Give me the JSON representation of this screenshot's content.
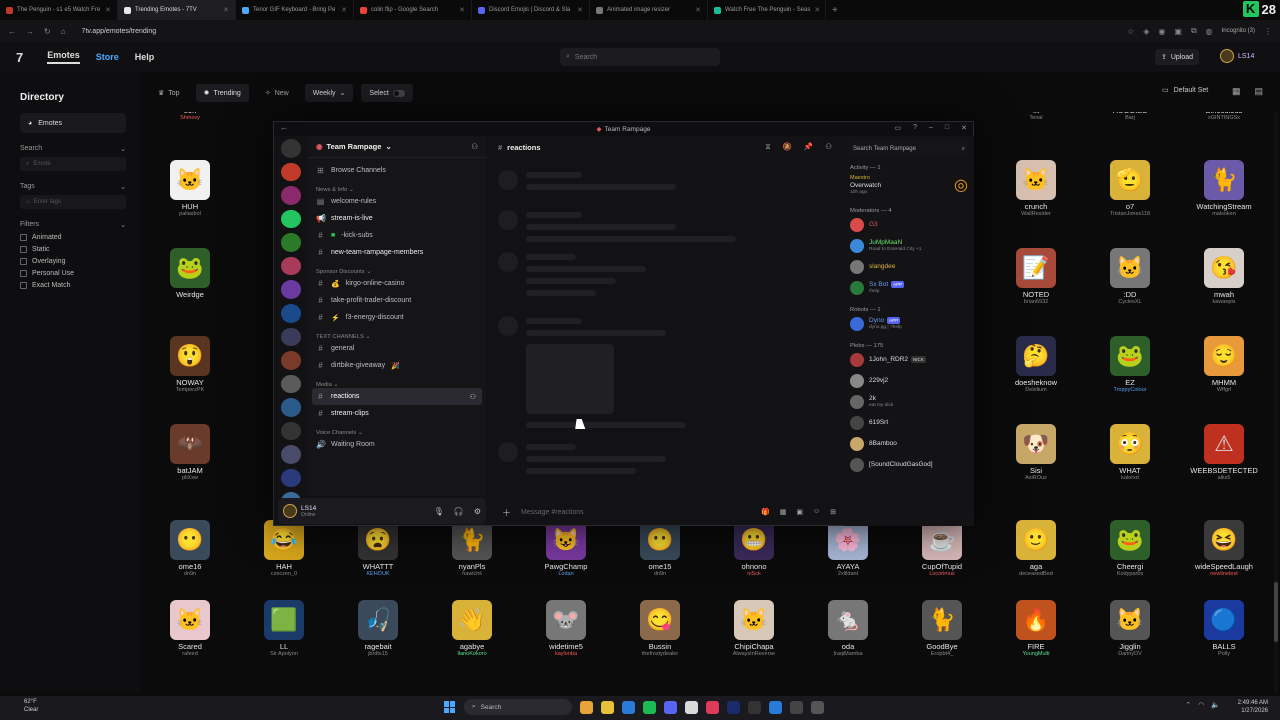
{
  "browser": {
    "tabs": [
      {
        "title": "The Penguin - s1 e5 Watch Fre",
        "color": "#c0392b"
      },
      {
        "title": "Trending Emotes - 7TV",
        "color": "#e8e8e8",
        "active": true
      },
      {
        "title": "Tenor GIF Keyboard - Bring Pe",
        "color": "#4aa8ff"
      },
      {
        "title": "colin flip - Google Search",
        "color": "#ea4335"
      },
      {
        "title": "Discord Emojis | Discord & Sla",
        "color": "#5865f2"
      },
      {
        "title": "Animated image resizer",
        "color": "#777777"
      },
      {
        "title": "Watch Free The Penguin - Seas",
        "color": "#1abc9c"
      }
    ],
    "url": "7tv.app/emotes/trending",
    "incognito": "Incognito (3)",
    "kick_count": "28"
  },
  "site": {
    "nav": {
      "emotes": "Emotes",
      "store": "Store",
      "help": "Help"
    },
    "search_placeholder": "Search",
    "upload": "Upload",
    "username": "LS14"
  },
  "sidebar": {
    "title": "Directory",
    "category": "Emotes",
    "search_label": "Search",
    "search_placeholder": "Emote",
    "tags_label": "Tags",
    "tags_placeholder": "Enter tags",
    "filters_label": "Filters",
    "filters": [
      "Animated",
      "Static",
      "Overlaying",
      "Personal Use",
      "Exact Match"
    ]
  },
  "filterbar": {
    "top": "Top",
    "trending": "Trending",
    "new": "New",
    "period": "Weekly",
    "select": "Select",
    "default_set": "Default Set"
  },
  "emotes": [
    {
      "name": "eon",
      "author": "Shmovy",
      "icon": "",
      "bg": "#222",
      "c": "red",
      "row": 0,
      "col": 0
    },
    {
      "name": "HUH",
      "author": "paliasbol",
      "icon": "🐱",
      "bg": "#f1f1f1",
      "row": 1,
      "col": 0
    },
    {
      "name": "Weirdge",
      "author": "",
      "icon": "🐸",
      "bg": "#2e5e2a",
      "row": 2,
      "col": 0
    },
    {
      "name": "NOWAY",
      "author": "TemperzPK",
      "icon": "😲",
      "bg": "#5a3520",
      "row": 3,
      "col": 0
    },
    {
      "name": "batJAM",
      "author": "pliXxw",
      "icon": "🦇",
      "bg": "#6a3a2a",
      "row": 4,
      "col": 0
    },
    {
      "name": "ome16",
      "author": "dn9n",
      "icon": "😶",
      "bg": "#3a4a5a",
      "row": 5,
      "col": 0
    },
    {
      "name": "Scared",
      "author": "rafeed",
      "icon": "🐱",
      "bg": "#e8c8cc",
      "row": 6,
      "col": 0
    },
    {
      "name": "HAH",
      "author": "czeczen_0",
      "icon": "😂",
      "bg": "#d9a81e",
      "row": 5,
      "col": 1
    },
    {
      "name": "LL",
      "author": "Sir Apolyon",
      "icon": "🟩",
      "bg": "#1a3a6a",
      "row": 6,
      "col": 1
    },
    {
      "name": "WHATTT",
      "author": "KEHOUK",
      "icon": "😧",
      "bg": "#333",
      "c": "blue",
      "row": 5,
      "col": 2
    },
    {
      "name": "ragebait",
      "author": "jbrdts15",
      "icon": "🎣",
      "bg": "#3a4a5a",
      "row": 6,
      "col": 2
    },
    {
      "name": "nyanPls",
      "author": "hawichii",
      "icon": "🐈",
      "bg": "#555",
      "row": 5,
      "col": 3
    },
    {
      "name": "agabye",
      "author": "IlanoKokoro",
      "icon": "👋",
      "bg": "#d9b23a",
      "c": "green",
      "row": 6,
      "col": 3
    },
    {
      "name": "PawgChamp",
      "author": "Lodan",
      "icon": "😺",
      "bg": "#7a3aa0",
      "c": "blue",
      "row": 5,
      "col": 4
    },
    {
      "name": "widetime5",
      "author": "kaylonba",
      "icon": "🐭",
      "bg": "#777",
      "c": "red",
      "row": 6,
      "col": 4
    },
    {
      "name": "ome15",
      "author": "dn9n",
      "icon": "😶",
      "bg": "#3a4a5a",
      "row": 5,
      "col": 5
    },
    {
      "name": "Bussin",
      "author": "thefrostydealer",
      "icon": "😋",
      "bg": "#8a6a4a",
      "row": 6,
      "col": 5
    },
    {
      "name": "ohnono",
      "author": "niSck",
      "icon": "😬",
      "bg": "#3a2a5a",
      "c": "red",
      "row": 5,
      "col": 6
    },
    {
      "name": "ChipiChapa",
      "author": "AlwaysInReverse",
      "icon": "🐱",
      "bg": "#d8c8b8",
      "row": 6,
      "col": 6
    },
    {
      "name": "AYAYA",
      "author": "2xlildant",
      "icon": "🌸",
      "bg": "#aab8d8",
      "row": 5,
      "col": 7
    },
    {
      "name": "oda",
      "author": "IraqiMamba",
      "icon": "🐁",
      "bg": "#777",
      "row": 6,
      "col": 7
    },
    {
      "name": "CupOfTupid",
      "author": "Locorimus",
      "icon": "☕",
      "bg": "#d8b8b8",
      "c": "red",
      "row": 5,
      "col": 8
    },
    {
      "name": "GoodBye",
      "author": "Eropbt4_",
      "icon": "🐈",
      "bg": "#555",
      "row": 6,
      "col": 8
    },
    {
      "name": "aga",
      "author": "deceasedBed",
      "icon": "🙂",
      "bg": "#d9b23a",
      "row": 5,
      "col": 9
    },
    {
      "name": "FIRE",
      "author": "YoungMulti",
      "icon": "🔥",
      "bg": "#c0521e",
      "c": "green",
      "row": 6,
      "col": 9
    },
    {
      "name": "Cheergi",
      "author": "Kodyparbs",
      "icon": "🐸",
      "bg": "#2e5e2a",
      "row": 5,
      "col": 10
    },
    {
      "name": "Jigglin",
      "author": "DannyDV",
      "icon": "🐱",
      "bg": "#555",
      "row": 6,
      "col": 10
    },
    {
      "name": "wideSpeedLaugh",
      "author": "newlinetest",
      "icon": "😆",
      "bg": "#3a3a3a",
      "c": "red",
      "row": 5,
      "col": 11
    },
    {
      "name": "BALLS",
      "author": "Polly",
      "icon": "🔵",
      "bg": "#1a3aa0",
      "row": 6,
      "col": 11
    },
    {
      "name": "Sisi",
      "author": "AxiROuz",
      "icon": "🐶",
      "bg": "#c8a868",
      "row": 4,
      "col": 9
    },
    {
      "name": "WHAT",
      "author": "kalorxd",
      "icon": "😳",
      "bg": "#d9b23a",
      "row": 4,
      "col": 10
    },
    {
      "name": "WEEBSDETECTED",
      "author": "alks5",
      "icon": "⚠",
      "bg": "#c0301e",
      "row": 4,
      "col": 11
    },
    {
      "name": "doesheknow",
      "author": "Debilium",
      "icon": "🤔",
      "bg": "#2a2a4a",
      "row": 3,
      "col": 9
    },
    {
      "name": "EZ",
      "author": "TroppyColour",
      "icon": "🐸",
      "bg": "#2e5e2a",
      "c": "blue",
      "row": 3,
      "col": 10
    },
    {
      "name": "MHMM",
      "author": "Wffgrl",
      "icon": "😌",
      "bg": "#e89a3a",
      "row": 3,
      "col": 11
    },
    {
      "name": "NOTED",
      "author": "brian6932",
      "icon": "📝",
      "bg": "#a84a3a",
      "row": 2,
      "col": 9
    },
    {
      "name": ":DD",
      "author": "CyclesXL",
      "icon": "🐱",
      "bg": "#777",
      "row": 2,
      "col": 10
    },
    {
      "name": "mwah",
      "author": "kawanpis",
      "icon": "😘",
      "bg": "#d8d0c8",
      "row": 2,
      "col": 11
    },
    {
      "name": "crunch",
      "author": "WallResider",
      "icon": "🐱",
      "bg": "#d8c0b0",
      "row": 1,
      "col": 9
    },
    {
      "name": "o7",
      "author": "TristanJones118",
      "icon": "🫡",
      "bg": "#d9b23a",
      "row": 1,
      "col": 10
    },
    {
      "name": "WatchingStream",
      "author": "malsoken",
      "icon": "🐈",
      "bg": "#6a5aa8",
      "row": 1,
      "col": 11
    },
    {
      "name": "fft",
      "author": "Tenal",
      "icon": "",
      "bg": "#222",
      "row": 0,
      "col": 9
    },
    {
      "name": "HUGGIES",
      "author": "Barj",
      "icon": "",
      "bg": "#222",
      "row": 0,
      "col": 10
    },
    {
      "name": "Binoculous",
      "author": "xGINTINGSx",
      "icon": "",
      "bg": "#222",
      "row": 0,
      "col": 11
    }
  ],
  "discord": {
    "window_title": "Team Rampage",
    "server_name": "Team Rampage",
    "browse": "Browse Channels",
    "categories": {
      "news": "News & Info",
      "sponsor": "Sponsor Discounts",
      "text": "TEXT CHANNELS",
      "media": "Media",
      "voice": "Voice Channels"
    },
    "channels": {
      "welcome": "welcome-rules",
      "stream_live": "stream-is-live",
      "kick": "-kick-subs",
      "new_members": "new-team-rampage-members",
      "kirgo": "kirgo-online-casino",
      "take_profit": "take-profit-trader-discount",
      "f3": "f3-energy-discount",
      "general": "general",
      "dirtbike": "dirtbike-giveaway",
      "reactions": "reactions",
      "clips": "stream-clips",
      "waiting": "Waiting Room"
    },
    "current_channel": "reactions",
    "composer_placeholder": "Message #reactions",
    "user": {
      "name": "LS14",
      "status": "Online"
    },
    "members": {
      "search": "Search Team Rampage",
      "activity_label": "Activity — 1",
      "activity_user": "Maestro",
      "activity_game": "Overwatch",
      "activity_time": "10h ago",
      "mods_label": "Moderators — 4",
      "mods": [
        {
          "name": "G3",
          "status": "",
          "tag": "",
          "color": "#d94a4a"
        },
        {
          "name": "JuMpMaaN",
          "status": "Road to Emerald City +1",
          "tag": "",
          "color": "#3a8ad9"
        },
        {
          "name": "slangdee",
          "status": "",
          "tag": "",
          "color": "#777"
        },
        {
          "name": "Sx Bot",
          "status": "/help",
          "tag": "APP",
          "color": "#2a7a3a"
        }
      ],
      "robots_label": "Robots — 1",
      "robot": {
        "name": "Dyno",
        "status": "dyno.gg | ?help",
        "tag": "APP",
        "color": "#3a6ad9"
      },
      "plebs_label": "Plebs — 175",
      "plebs": [
        {
          "name": "1John_RDR2",
          "status": "",
          "tag": "NICK",
          "color": "#a83a3a"
        },
        {
          "name": "229vj2",
          "status": "",
          "tag": "",
          "color": "#888"
        },
        {
          "name": "2k",
          "status": "eat my dick",
          "tag": "",
          "color": "#666"
        },
        {
          "name": "619Srt",
          "status": "",
          "tag": "",
          "color": "#444"
        },
        {
          "name": "8Bamboo",
          "status": "",
          "tag": "",
          "color": "#c8a868"
        },
        {
          "name": "[SoundCloudGasGod]",
          "status": "",
          "tag": "",
          "color": "#555"
        }
      ]
    }
  },
  "taskbar": {
    "weather_temp": "62°F",
    "weather_desc": "Clear",
    "search": "Search",
    "time": "2:49:46 AM",
    "date": "1/27/2026"
  }
}
